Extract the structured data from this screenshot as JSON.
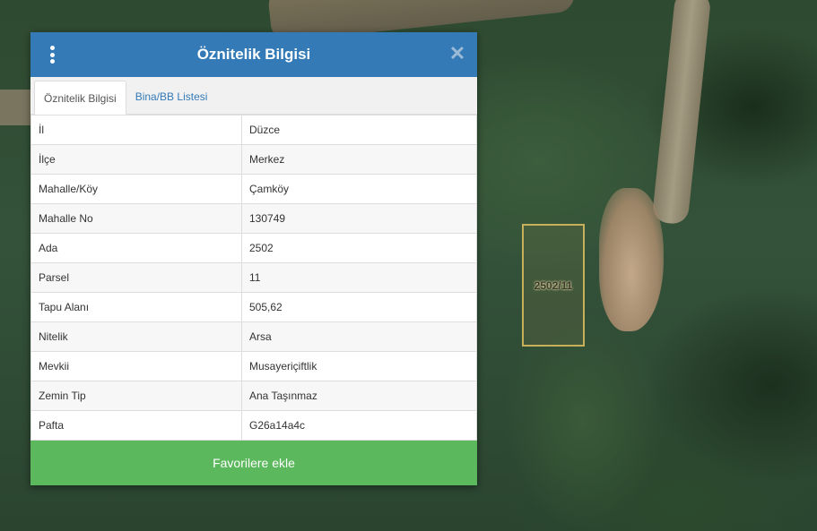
{
  "panel": {
    "title": "Öznitelik Bilgisi",
    "menu_icon": "vertical-dots-icon",
    "close_icon": "close-icon",
    "close_glyph": "✕",
    "tabs": [
      {
        "label": "Öznitelik Bilgisi",
        "active": true
      },
      {
        "label": "Bina/BB Listesi",
        "active": false
      }
    ],
    "rows": [
      {
        "key": "İl",
        "value": "Düzce"
      },
      {
        "key": "İlçe",
        "value": "Merkez"
      },
      {
        "key": "Mahalle/Köy",
        "value": "Çamköy"
      },
      {
        "key": "Mahalle No",
        "value": "130749"
      },
      {
        "key": "Ada",
        "value": "2502"
      },
      {
        "key": "Parsel",
        "value": "11"
      },
      {
        "key": "Tapu Alanı",
        "value": "505,62"
      },
      {
        "key": "Nitelik",
        "value": "Arsa"
      },
      {
        "key": "Mevkii",
        "value": "Musayeriçiftlik"
      },
      {
        "key": "Zemin Tip",
        "value": "Ana Taşınmaz"
      },
      {
        "key": "Pafta",
        "value": "G26a14a4c"
      }
    ],
    "favorite_button": "Favorilere ekle"
  },
  "map": {
    "parcel_label": "2502/11"
  },
  "colors": {
    "header": "#337ab7",
    "button": "#5cb85c",
    "parcel_border": "#c8b05a"
  }
}
